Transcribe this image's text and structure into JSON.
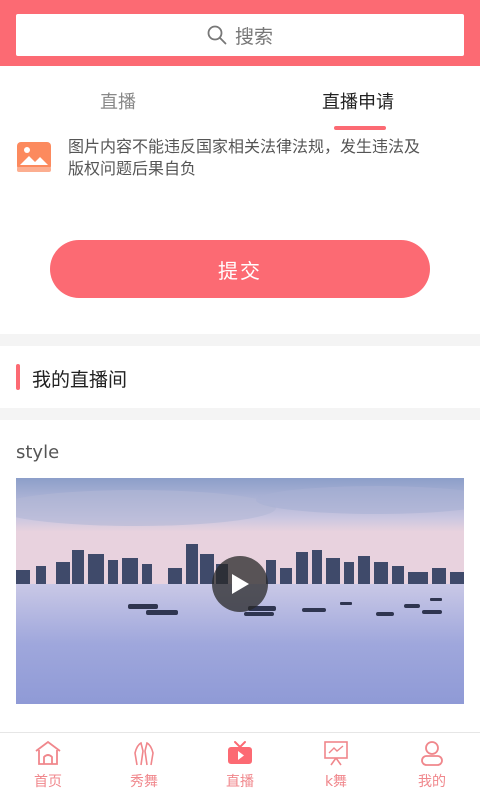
{
  "search": {
    "placeholder": "搜索",
    "icon": "search-icon"
  },
  "tabs": [
    {
      "label": "直播",
      "active": false
    },
    {
      "label": "直播申请",
      "active": true
    }
  ],
  "form": {
    "icon": "image-icon",
    "notice": "图片内容不能违反国家相关法律法规，发生违法及版权问题后果自负",
    "submit_label": "提交"
  },
  "section": {
    "title": "我的直播间"
  },
  "room": {
    "name": "style",
    "thumbnail": "city-skyline-over-water",
    "play_icon": "play-icon"
  },
  "tabbar": [
    {
      "label": "首页",
      "icon": "home-icon"
    },
    {
      "label": "秀舞",
      "icon": "dance-icon"
    },
    {
      "label": "直播",
      "icon": "tv-icon"
    },
    {
      "label": "k舞",
      "icon": "presentation-icon"
    },
    {
      "label": "我的",
      "icon": "user-icon"
    }
  ],
  "colors": {
    "accent": "#fc6a73",
    "tabbar_label": "#f0878c"
  }
}
